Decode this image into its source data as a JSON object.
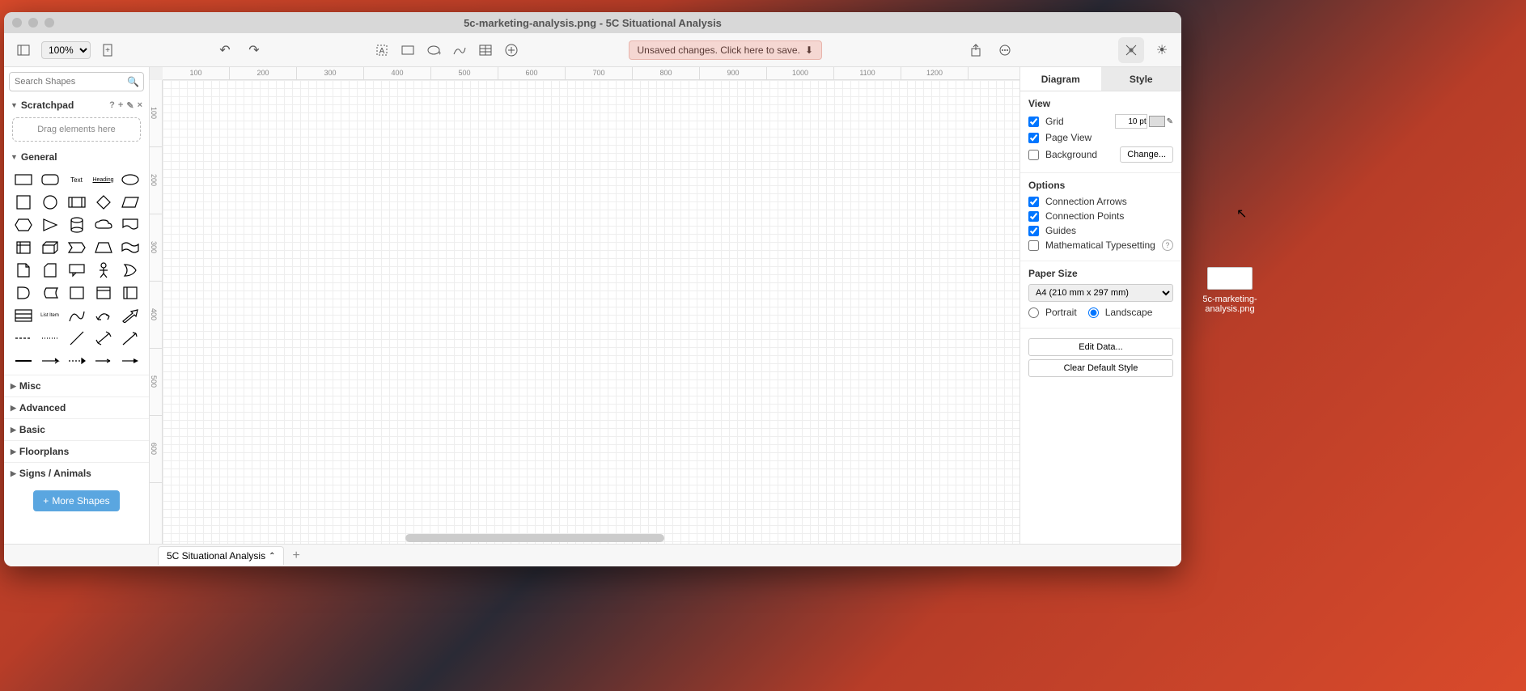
{
  "window_title": "5c-marketing-analysis.png - 5C Situational Analysis",
  "toolbar": {
    "zoom": "100%",
    "unsaved_banner": "Unsaved changes. Click here to save."
  },
  "sidebar": {
    "search_placeholder": "Search Shapes",
    "scratchpad_label": "Scratchpad",
    "scratchpad_drop": "Drag elements here",
    "general_label": "General",
    "text_label": "Text",
    "heading_label": "Heading",
    "listitem_label": "List Item",
    "categories": [
      "Misc",
      "Advanced",
      "Basic",
      "Floorplans",
      "Signs / Animals"
    ],
    "more_shapes": "More Shapes"
  },
  "ruler_h": [
    "100",
    "200",
    "300",
    "400",
    "500",
    "600",
    "700",
    "800",
    "900",
    "1000",
    "1100",
    "1200"
  ],
  "ruler_v": [
    "100",
    "200",
    "300",
    "400",
    "500",
    "600"
  ],
  "right": {
    "tab_diagram": "Diagram",
    "tab_style": "Style",
    "view_heading": "View",
    "grid_label": "Grid",
    "grid_value": "10 pt",
    "page_view_label": "Page View",
    "background_label": "Background",
    "change_btn": "Change...",
    "options_heading": "Options",
    "conn_arrows": "Connection Arrows",
    "conn_points": "Connection Points",
    "guides": "Guides",
    "math_type": "Mathematical Typesetting",
    "paper_heading": "Paper Size",
    "paper_value": "A4 (210 mm x 297 mm)",
    "portrait": "Portrait",
    "landscape": "Landscape",
    "edit_data": "Edit Data...",
    "clear_style": "Clear Default Style"
  },
  "footer": {
    "page_tab": "5C Situational Analysis"
  },
  "desktop": {
    "filename": "5c-marketing-analysis.png"
  }
}
